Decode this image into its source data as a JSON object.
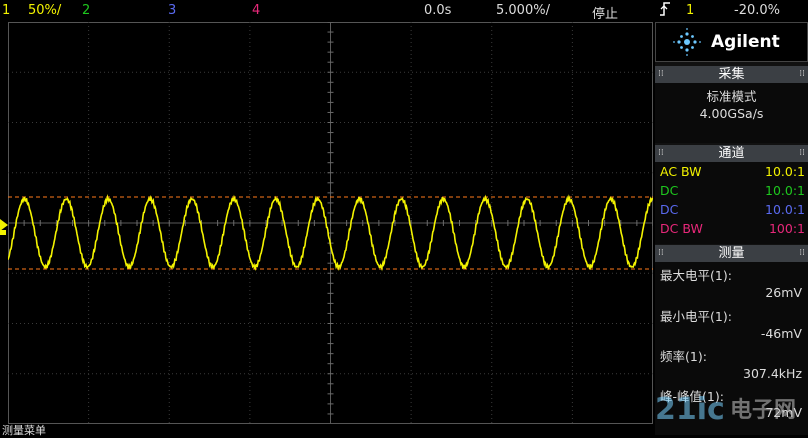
{
  "topbar": {
    "ch1": "1",
    "ch1_scale": "50%/",
    "ch2": "2",
    "ch3": "3",
    "ch4": "4",
    "time_delay": "0.0s",
    "time_scale": "5.000%/",
    "run_state": "停止",
    "trigger_icon": "rising-edge-icon",
    "trigger_source": "1",
    "trigger_level": "-20.0%"
  },
  "panel": {
    "brand": "Agilent",
    "acquire": {
      "header": "采集",
      "mode": "标准模式",
      "rate": "4.00GSa/s"
    },
    "channels": {
      "header": "通道",
      "rows": [
        {
          "coupling": "AC BW",
          "probe": "10.0:1",
          "color": "#f3f300"
        },
        {
          "coupling": "DC",
          "probe": "10.0:1",
          "color": "#1ec81e"
        },
        {
          "coupling": "DC",
          "probe": "10.0:1",
          "color": "#5a6af0"
        },
        {
          "coupling": "DC BW",
          "probe": "100:1",
          "color": "#e8287a"
        }
      ]
    },
    "measure": {
      "header": "测量",
      "items": [
        {
          "label": "最大电平(1):",
          "value": "26mV"
        },
        {
          "label": "最小电平(1):",
          "value": "-46mV"
        },
        {
          "label": "频率(1):",
          "value": "307.4kHz"
        },
        {
          "label": "峰-峰值(1):",
          "value": "72mV"
        }
      ]
    }
  },
  "footer": {
    "label": "测量菜单"
  },
  "watermark": {
    "brand": "21ic",
    "sub": "电子网"
  },
  "colors": {
    "ch1": "#f3f300",
    "ch2": "#1ec81e",
    "ch3": "#5a6af0",
    "ch4": "#e8287a",
    "marker_orange": "#ff7a1a",
    "grid": "#3a3a3a"
  },
  "waveform": {
    "cycles_shown": 15.4
  }
}
